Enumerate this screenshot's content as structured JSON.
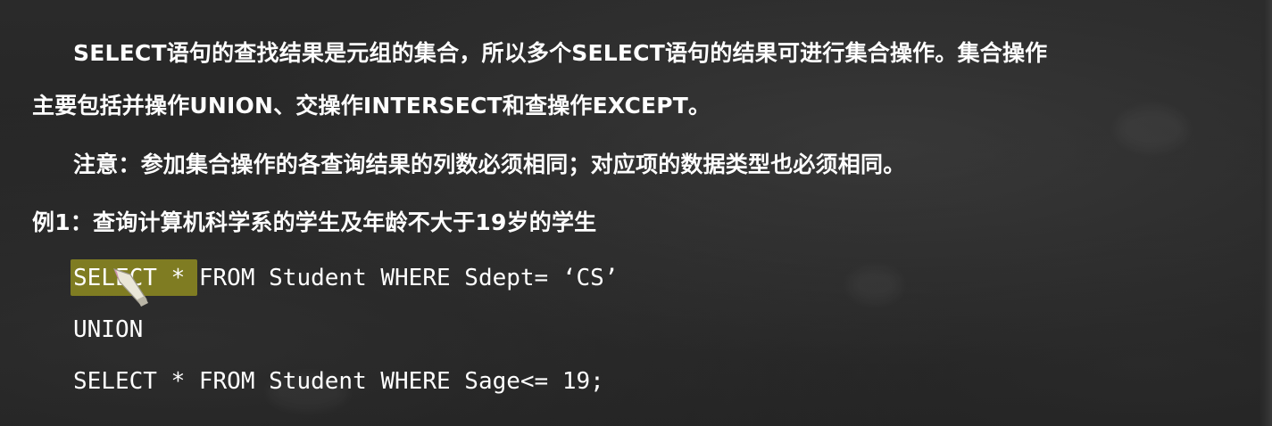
{
  "slide": {
    "paragraph1_line1": "SELECT语句的查找结果是元组的集合，所以多个SELECT语句的结果可进行集合操作。集合操作",
    "paragraph1_line2": "主要包括并操作UNION、交操作INTERSECT和查操作EXCEPT。",
    "note": "注意：参加集合操作的各查询结果的列数必须相同；对应项的数据类型也必须相同。",
    "example_title": "例1：查询计算机科学系的学生及年龄不大于19岁的学生",
    "code": {
      "line1": "SELECT * FROM Student WHERE Sdept= ‘CS’",
      "line2": "UNION",
      "line3": "SELECT * FROM Student WHERE Sage<= 19;"
    }
  },
  "icons": {
    "cursor": "chalk-pen-cursor-icon"
  },
  "colors": {
    "background": "#202020",
    "text": "#ffffff",
    "highlight": "#7f7c22"
  }
}
